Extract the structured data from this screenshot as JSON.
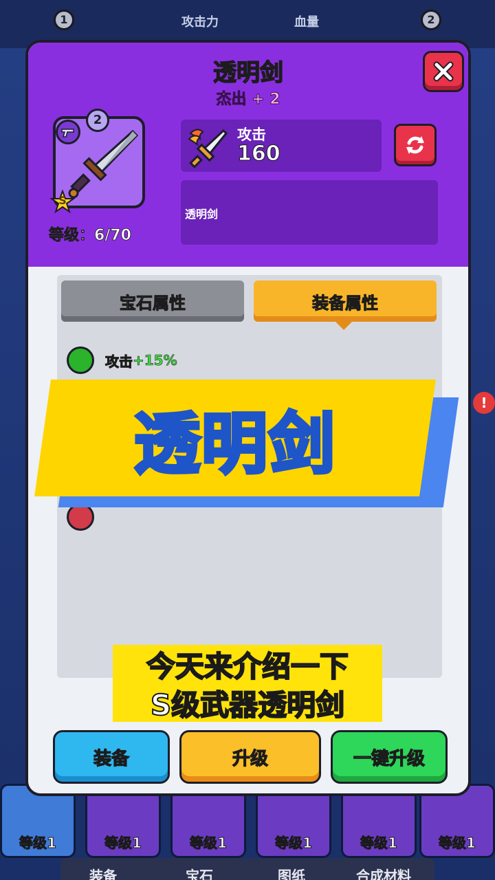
{
  "background": {
    "stats": [
      {
        "label": "攻击力"
      },
      {
        "label": "血量"
      }
    ],
    "cards_levels": [
      "等级1",
      "等级1",
      "等级1",
      "等级1",
      "等级1",
      "等级1"
    ],
    "tabs": [
      "装备",
      "宝石",
      "图纸",
      "合成材料"
    ],
    "badges": [
      "1",
      "2"
    ]
  },
  "modal": {
    "title": "透明剑",
    "subtitle": "杰出 + 2",
    "item": {
      "count": "2",
      "rank": "S",
      "level_text": "等级：6/70"
    },
    "stat": {
      "label": "攻击",
      "value": "160"
    },
    "description": "透明剑",
    "tabs": {
      "gem": "宝石属性",
      "equip": "装备属性",
      "active": "equip"
    },
    "attributes": [
      {
        "label": "攻击",
        "bonus": "+15%"
      }
    ],
    "buttons": {
      "equip": "装备",
      "upgrade": "升级",
      "one_click": "一键升级"
    }
  },
  "overlay": {
    "banner": "透明剑",
    "caption_line1": "今天来介绍一下",
    "caption_line2": "S级武器透明剑"
  },
  "colors": {
    "modal_header": "#8a2fe0",
    "close_button": "#e8334a",
    "tab_active": "#f9b52a",
    "button_equip": "#2fb8f0",
    "button_upgrade": "#fbbf2a",
    "button_one_click": "#2ed65a",
    "banner_yellow": "#ffd500",
    "banner_blue": "#4a85f0"
  }
}
